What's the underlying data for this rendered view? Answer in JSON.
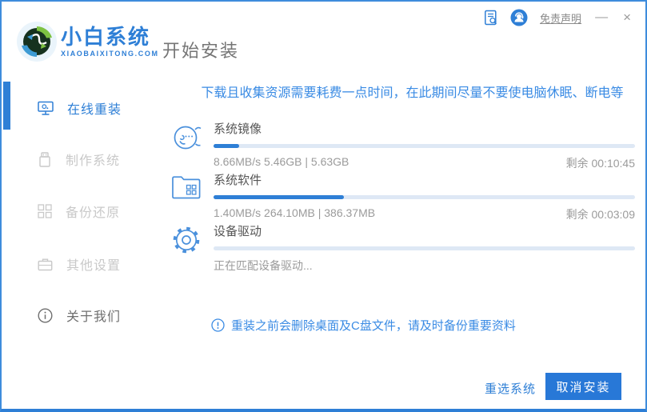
{
  "header": {
    "logo_title": "小白系统",
    "logo_subtitle": "XIAOBAIXITONG.COM",
    "page_title": "开始安装",
    "disclaimer_link": "免责声明",
    "minimize_label": "—",
    "close_label": "×",
    "icons": [
      "report-doc-icon",
      "customer-service-icon"
    ]
  },
  "sidebar": {
    "items": [
      {
        "label": "在线重装",
        "icon": "monitor-icon",
        "active": true
      },
      {
        "label": "制作系统",
        "icon": "usb-drive-icon",
        "active": false
      },
      {
        "label": "备份还原",
        "icon": "backup-blocks-icon",
        "active": false
      },
      {
        "label": "其他设置",
        "icon": "briefcase-icon",
        "active": false
      },
      {
        "label": "关于我们",
        "icon": "info-circle-icon",
        "active": false
      }
    ]
  },
  "main": {
    "warning_text": "下载且收集资源需要耗费一点时间，在此期间尽量不要使电脑休眠、断电等",
    "tasks": [
      {
        "name": "系统镜像",
        "icon": "mascot-face-icon",
        "progress_percent": 6,
        "stats": "8.66MB/s 5.46GB | 5.63GB",
        "remaining": "剩余 00:10:45"
      },
      {
        "name": "系统软件",
        "icon": "folder-grid-icon",
        "progress_percent": 31,
        "stats": "1.40MB/s 264.10MB | 386.37MB",
        "remaining": "剩余 00:03:09"
      },
      {
        "name": "设备驱动",
        "icon": "gear-icon",
        "progress_percent": 0,
        "stats": "正在匹配设备驱动...",
        "remaining": ""
      }
    ],
    "note_text": "重装之前会删除桌面及C盘文件，请及时备份重要资料"
  },
  "footer": {
    "reselect_label": "重选系统",
    "cancel_label": "取消安装"
  },
  "colors": {
    "accent_blue": "#2E7FD6",
    "link_blue": "#3A8BE4",
    "border_blue": "#3E8CDC",
    "button_blue": "#2878D7",
    "progress_track": "#DEE8F5",
    "inactive_gray": "#C9C9C9",
    "stats_gray": "#9B9B9B"
  }
}
